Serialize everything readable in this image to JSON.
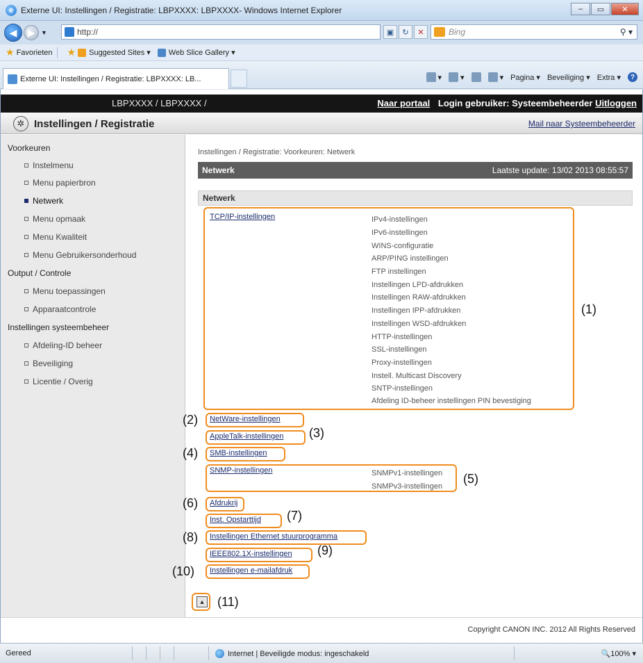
{
  "window": {
    "title": "Externe UI: Instellingen / Registratie: LBPXXXX: LBPXXXX- Windows Internet Explorer",
    "controls": {
      "minimize": "–",
      "maximize": "▭",
      "close": "✕"
    }
  },
  "address_bar": {
    "url": "http://",
    "search_placeholder": "Bing"
  },
  "favorites_bar": {
    "favorites_label": "Favorieten",
    "items": [
      "Suggested Sites ▾",
      "Web Slice Gallery ▾"
    ]
  },
  "tab": {
    "label": "Externe UI: Instellingen / Registratie: LBPXXXX: LB..."
  },
  "command_bar": {
    "page": "Pagina ▾",
    "safety": "Beveiliging ▾",
    "extra": "Extra ▾",
    "help": "?"
  },
  "topbar": {
    "device": "LBPXXXX / LBPXXXX /",
    "portal": "Naar portaal",
    "login": "Login gebruiker: Systeembeheerder",
    "logout": "Uitloggen"
  },
  "header": {
    "title": "Instellingen / Registratie",
    "mail": "Mail naar Systeembeheerder"
  },
  "sidebar": {
    "groups": [
      {
        "label": "Voorkeuren",
        "items": [
          "Instelmenu",
          "Menu papierbron",
          "Netwerk",
          "Menu opmaak",
          "Menu Kwaliteit",
          "Menu Gebruikersonderhoud"
        ]
      },
      {
        "label": "Output / Controle",
        "items": [
          "Menu toepassingen",
          "Apparaatcontrole"
        ]
      },
      {
        "label": "Instellingen systeembeheer",
        "items": [
          "Afdeling-ID beheer",
          "Beveiliging",
          "Licentie / Overig"
        ]
      }
    ]
  },
  "main": {
    "breadcrumb": "Instellingen / Registratie: Voorkeuren: Netwerk",
    "section_title": "Netwerk",
    "last_update": "Laatste update: 13/02 2013 08:55:57",
    "subsection_title": "Netwerk",
    "tcpip": {
      "label": "TCP/IP-instellingen",
      "items": [
        "IPv4-instellingen",
        "IPv6-instellingen",
        "WINS-configuratie",
        "ARP/PING instellingen",
        "FTP instellingen",
        "Instellingen LPD-afdrukken",
        "Instellingen RAW-afdrukken",
        "Instellingen IPP-afdrukken",
        "Instellingen WSD-afdrukken",
        "HTTP-instellingen",
        "SSL-instellingen",
        "Proxy-instellingen",
        "Instell. Multicast Discovery",
        "SNTP-instellingen",
        "Afdeling ID-beheer instellingen PIN bevestiging"
      ]
    },
    "netware": "NetWare-instellingen",
    "appletalk": "AppleTalk-instellingen",
    "smb": "SMB-instellingen",
    "snmp": {
      "label": "SNMP-instellingen",
      "items": [
        "SNMPv1-instellingen",
        "SNMPv3-instellingen"
      ]
    },
    "spool": "Afdrukrij",
    "startup": "Inst. Opstarttijd",
    "ethernet": "Instellingen Ethernet stuurprogramma",
    "ieee": "IEEE802.1X-instellingen",
    "email": "Instellingen e-mailafdruk",
    "top_button": "▲"
  },
  "callouts": [
    "(1)",
    "(2)",
    "(3)",
    "(4)",
    "(5)",
    "(6)",
    "(7)",
    "(8)",
    "(9)",
    "(10)",
    "(11)"
  ],
  "footer": {
    "copyright": "Copyright CANON INC. 2012 All Rights Reserved"
  },
  "statusbar": {
    "ready": "Gereed",
    "zone": "Internet | Beveiligde modus: ingeschakeld",
    "zoom": "🔍100% ▾"
  },
  "colors": {
    "highlight_box": "#f08c1e",
    "top_bar": "#151515",
    "section_bar": "#5d5d5d",
    "link": "#1a2a6c"
  }
}
